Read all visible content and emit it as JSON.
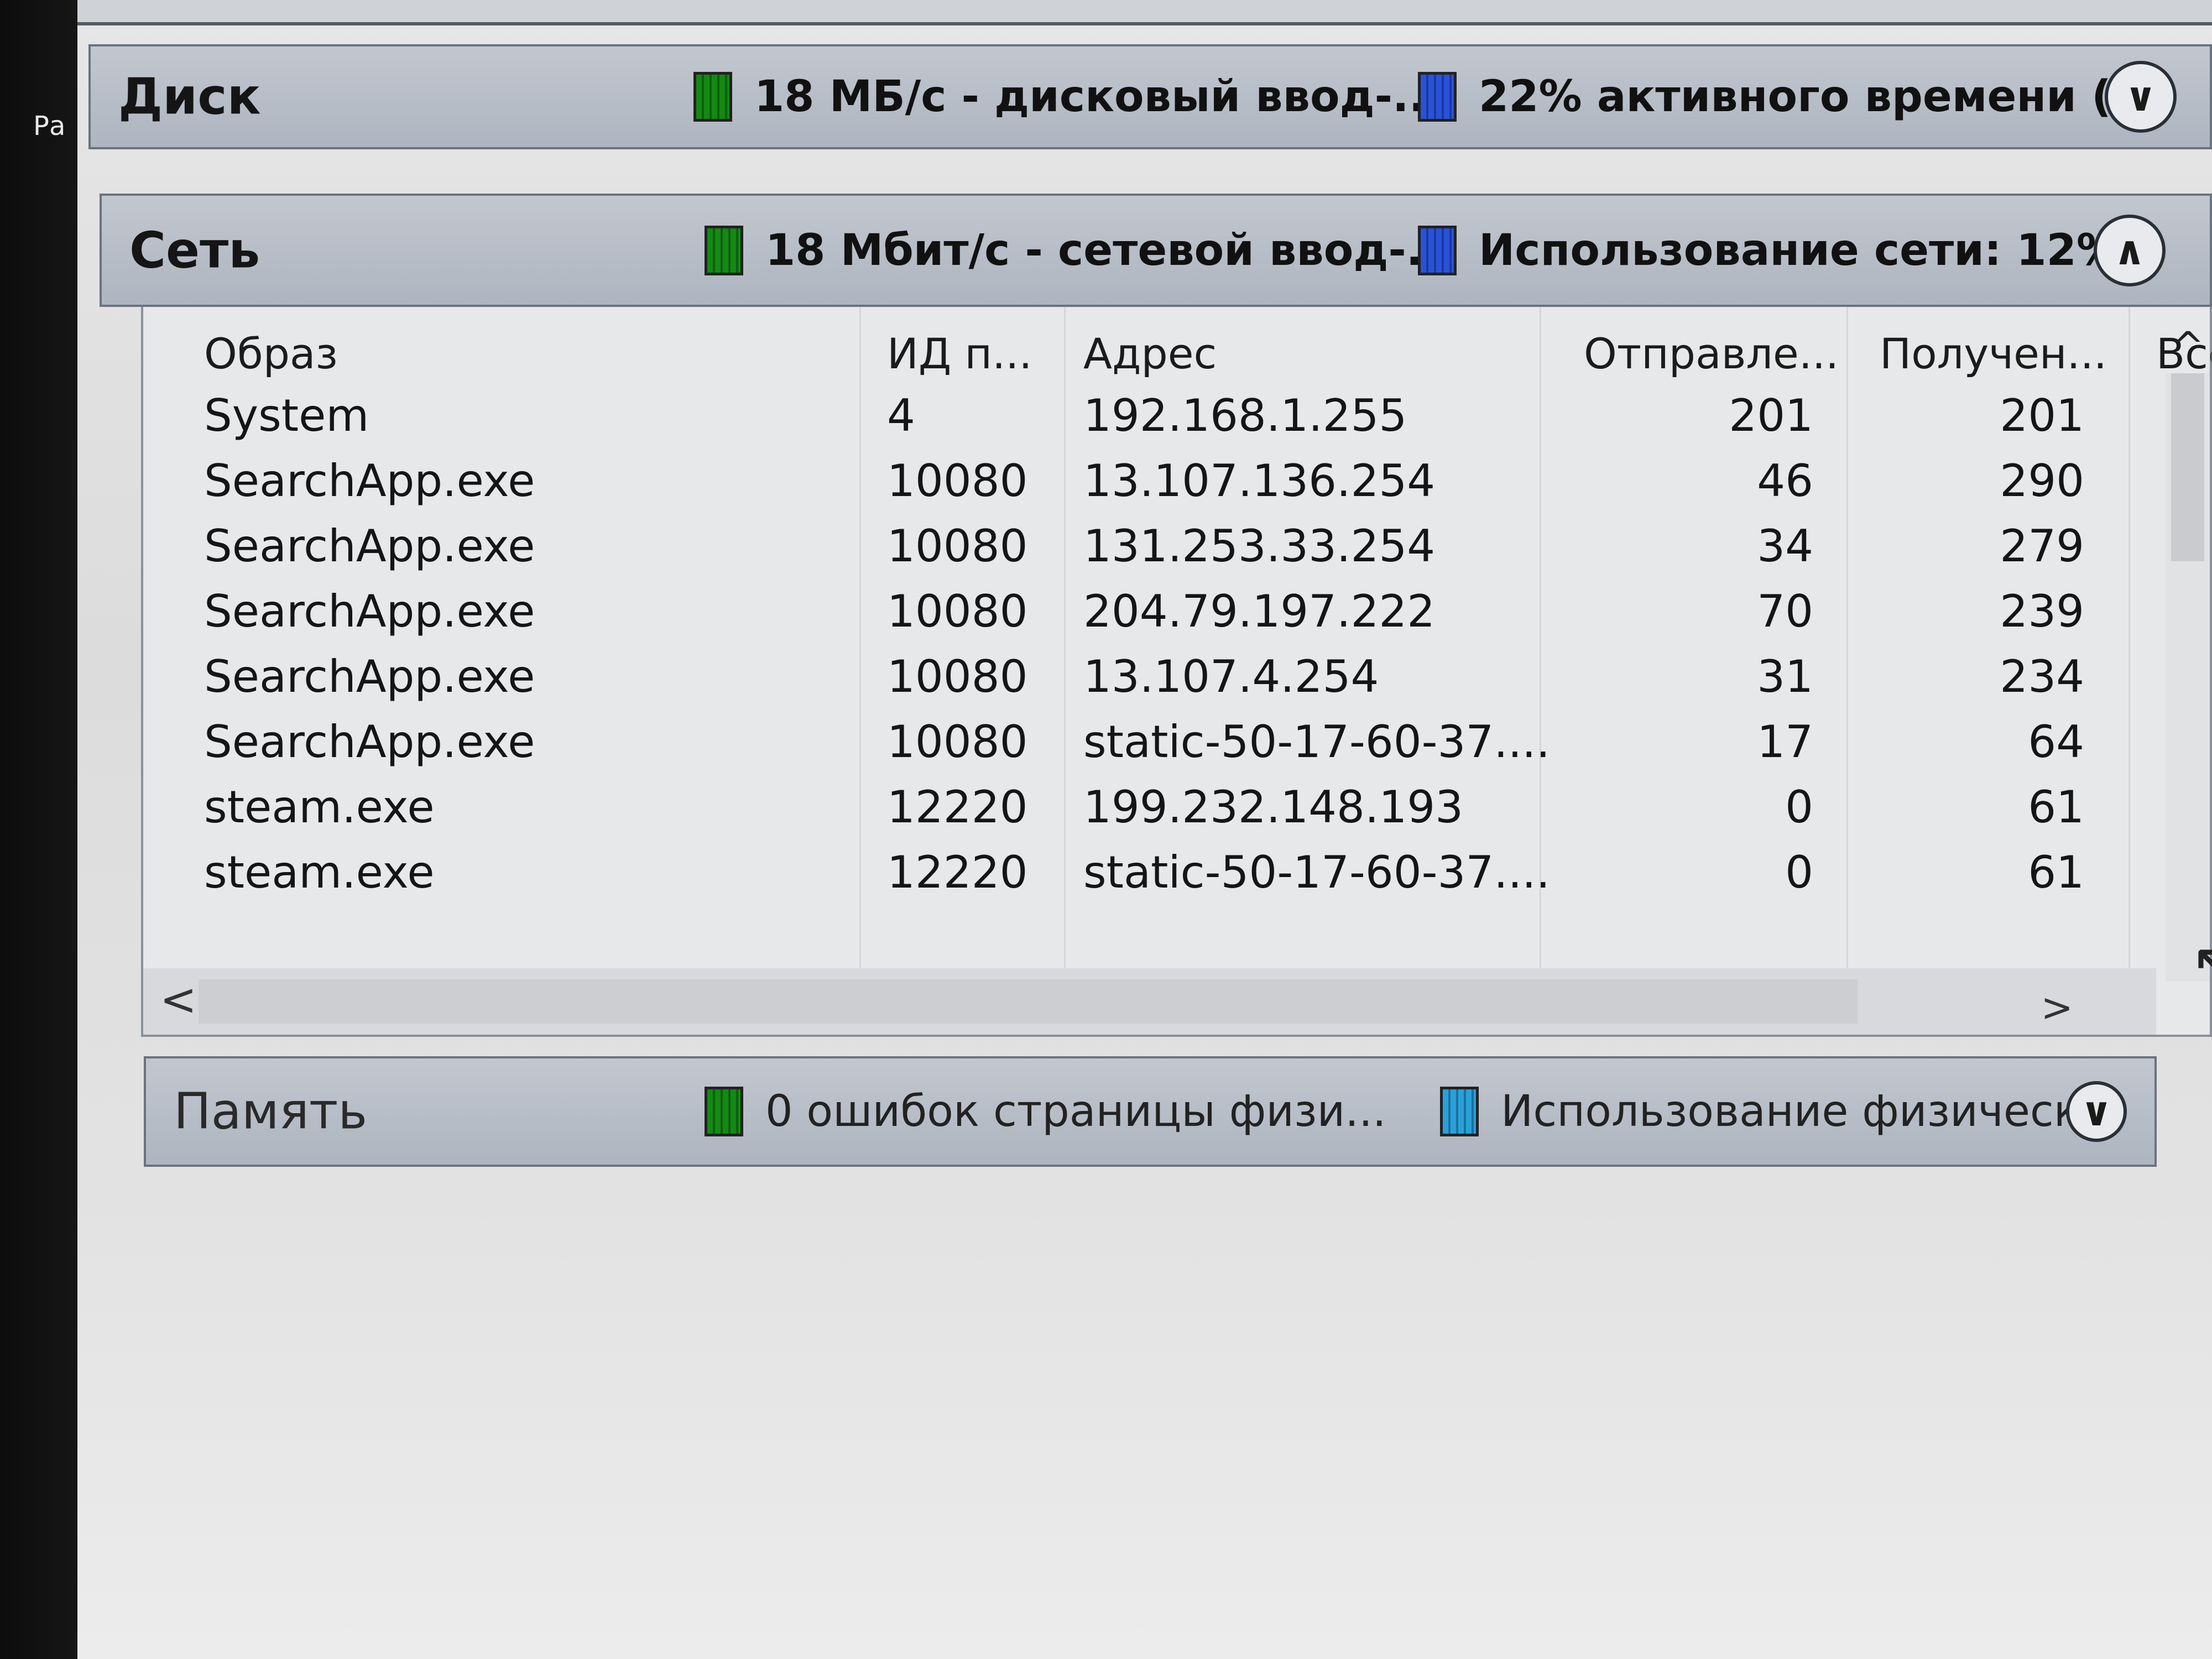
{
  "left_label": "Ра",
  "disk": {
    "title": "Диск",
    "legend1": "18 МБ/с - дисковый ввод-...",
    "legend2": "22% активного времени (...",
    "toggle": "∨"
  },
  "network": {
    "title": "Сеть",
    "legend1": "18 Мбит/с - сетевой ввод-...",
    "legend2": "Использование сети: 12%",
    "toggle": "∧",
    "columns": [
      "Образ",
      "ИД п...",
      "Адрес",
      "Отправле...",
      "Получен...",
      "Все"
    ],
    "rows": [
      {
        "image": "System",
        "pid": "4",
        "address": "192.168.1.255",
        "sent": "201",
        "received": "201"
      },
      {
        "image": "SearchApp.exe",
        "pid": "10080",
        "address": "13.107.136.254",
        "sent": "46",
        "received": "290"
      },
      {
        "image": "SearchApp.exe",
        "pid": "10080",
        "address": "131.253.33.254",
        "sent": "34",
        "received": "279"
      },
      {
        "image": "SearchApp.exe",
        "pid": "10080",
        "address": "204.79.197.222",
        "sent": "70",
        "received": "239"
      },
      {
        "image": "SearchApp.exe",
        "pid": "10080",
        "address": "13.107.4.254",
        "sent": "31",
        "received": "234"
      },
      {
        "image": "SearchApp.exe",
        "pid": "10080",
        "address": "static-50-17-60-37....",
        "sent": "17",
        "received": "64"
      },
      {
        "image": "steam.exe",
        "pid": "12220",
        "address": "199.232.148.193",
        "sent": "0",
        "received": "61"
      },
      {
        "image": "steam.exe",
        "pid": "12220",
        "address": "static-50-17-60-37....",
        "sent": "0",
        "received": "61"
      }
    ],
    "scroll_left": "<",
    "scroll_right": ">",
    "scroll_up": "^"
  },
  "memory": {
    "title": "Память",
    "legend1": "0 ошибок страницы физи...",
    "legend2": "Использование физическ...",
    "toggle": "∨"
  },
  "colors": {
    "header_bg": "#aeb5c0",
    "window_bg": "#e6e6e6",
    "green_swatch": "#138a13",
    "blue_swatch": "#2a52d8"
  }
}
